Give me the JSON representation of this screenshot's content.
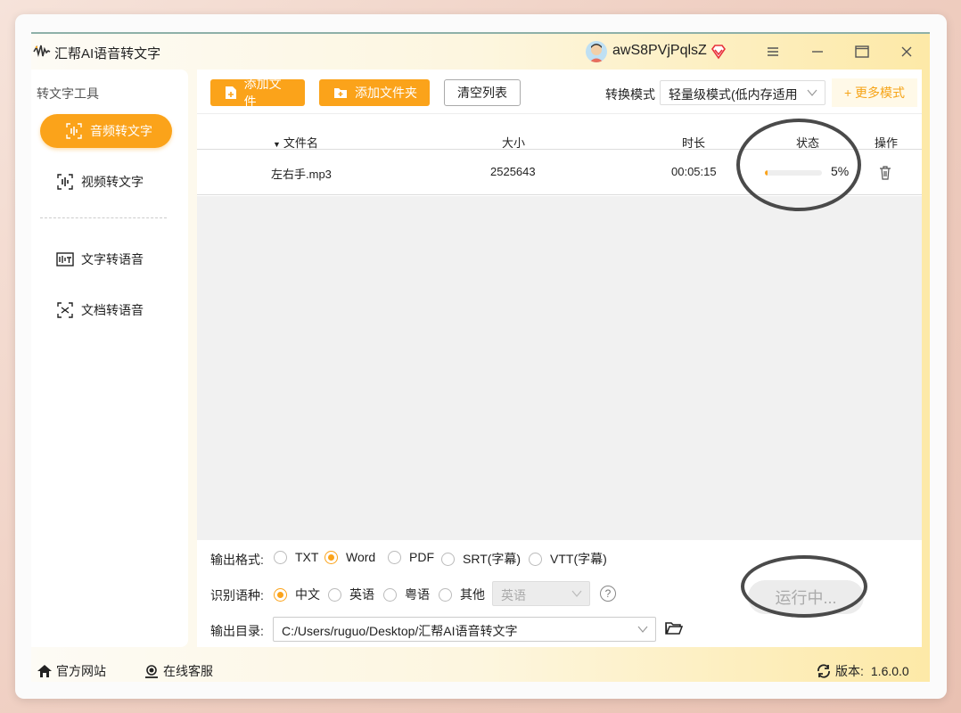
{
  "app": {
    "title": "汇帮AI语音转文字"
  },
  "user": {
    "name": "awS8PVjPqlsZ"
  },
  "sidebar": {
    "title": "转文字工具",
    "items": [
      {
        "label": "音频转文字",
        "icon": "audio-to-text-icon",
        "active": true
      },
      {
        "label": "视频转文字",
        "icon": "video-to-text-icon",
        "active": false
      },
      {
        "label": "文字转语音",
        "icon": "text-to-speech-icon",
        "active": false
      },
      {
        "label": "文档转语音",
        "icon": "doc-to-speech-icon",
        "active": false
      }
    ]
  },
  "toolbar": {
    "add_file": "添加文件",
    "add_folder": "添加文件夹",
    "clear_list": "清空列表",
    "mode_label": "转换模式",
    "mode_value": "轻量级模式(低内存适用",
    "more_modes": "+ 更多模式"
  },
  "table": {
    "headers": {
      "name": "文件名",
      "size": "大小",
      "duration": "时长",
      "status": "状态",
      "action": "操作"
    },
    "rows": [
      {
        "name": "左右手.mp3",
        "size": "2525643",
        "duration": "00:05:15",
        "progress": 5,
        "progress_text": "5%"
      }
    ]
  },
  "settings": {
    "format_label": "输出格式:",
    "formats": [
      "TXT",
      "Word",
      "PDF",
      "SRT(字幕)",
      "VTT(字幕)"
    ],
    "format_selected": "Word",
    "lang_label": "识别语种:",
    "langs": [
      "中文",
      "英语",
      "粤语",
      "其他"
    ],
    "lang_selected": "中文",
    "other_lang_value": "英语",
    "dir_label": "输出目录:",
    "dir_value": "C:/Users/ruguo/Desktop/汇帮AI语音转文字",
    "run_label": "运行中..."
  },
  "footer": {
    "website": "官方网站",
    "support": "在线客服",
    "version_label": "版本:",
    "version": "1.6.0.0"
  },
  "colors": {
    "accent": "#fba31a",
    "annotation": "#4a4a4a"
  }
}
